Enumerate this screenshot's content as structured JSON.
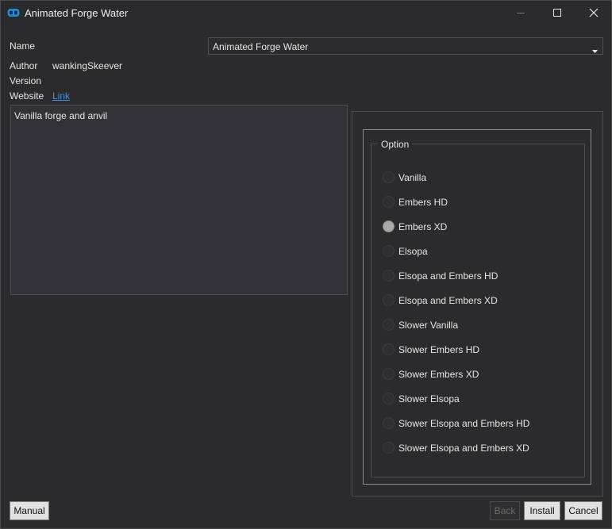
{
  "window": {
    "title": "Animated Forge Water"
  },
  "info": {
    "name_label": "Name",
    "name_value": "Animated Forge Water",
    "author_label": "Author",
    "author_value": "wankingSkeever",
    "version_label": "Version",
    "version_value": "",
    "website_label": "Website",
    "website_link": "Link",
    "description": "Vanilla forge and anvil"
  },
  "options": {
    "group_label": "Option",
    "selected": "Embers XD",
    "items": [
      "Vanilla",
      "Embers HD",
      "Embers XD",
      "Elsopa",
      "Elsopa and Embers HD",
      "Elsopa and Embers XD",
      "Slower Vanilla",
      "Slower Embers HD",
      "Slower Embers XD",
      "Slower Elsopa",
      "Slower Elsopa and Embers HD",
      "Slower Elsopa and Embers XD"
    ]
  },
  "buttons": {
    "manual": "Manual",
    "back": "Back",
    "install": "Install",
    "cancel": "Cancel"
  },
  "icons": {
    "app": "app-logo-icon",
    "minimize": "minimize-icon",
    "maximize": "maximize-icon",
    "close": "close-icon",
    "dropdown": "chevron-down-icon"
  },
  "colors": {
    "background": "#2b2b2d",
    "link": "#3f8fe8",
    "selected_radio": "#a9a9a9"
  }
}
